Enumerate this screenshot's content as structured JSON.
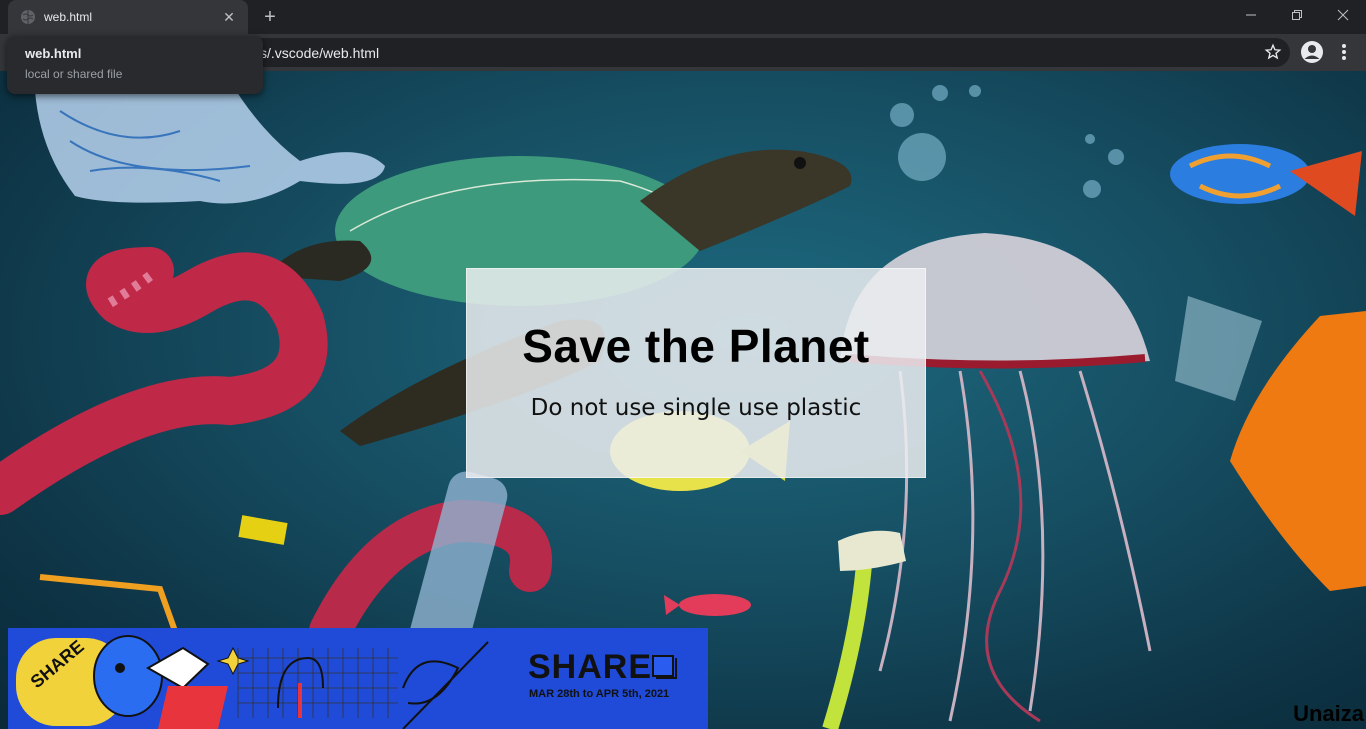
{
  "browser": {
    "tab": {
      "title": "web.html",
      "favicon": "globe-icon",
      "close_glyph": "✕"
    },
    "new_tab_glyph": "+",
    "address": {
      "url_visible": "s/.vscode/web.html",
      "bookmark_icon": "star-icon"
    },
    "tooltip": {
      "title": "web.html",
      "subtitle": "local or shared file"
    },
    "controls": [
      "minimize-icon",
      "restore-icon",
      "close-icon"
    ]
  },
  "page": {
    "heading": "Save the Planet",
    "tagline": "Do not use single use plastic",
    "signature": "Unaiza",
    "banner": {
      "brand": "SHARE",
      "dates": "MAR 28th to APR 5th, 2021",
      "arc_text": "SHARE",
      "accent": "#1f4bd8"
    }
  }
}
